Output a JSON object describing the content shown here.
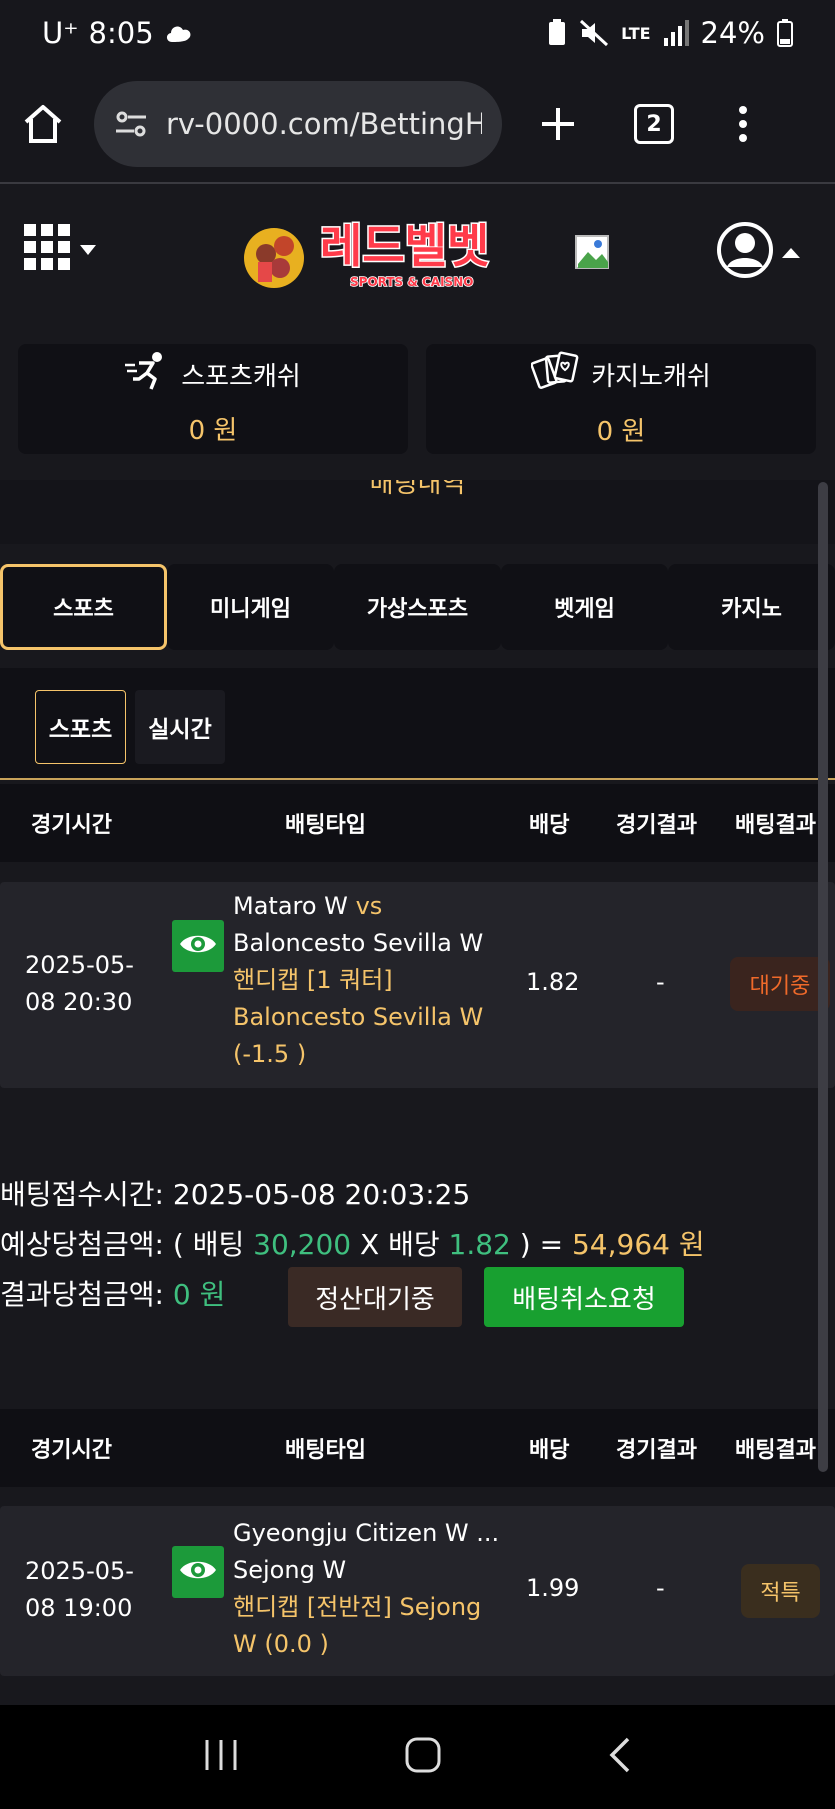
{
  "status_bar": {
    "carrier": "U⁺",
    "time": "8:05",
    "network": "LTE",
    "battery": "24%"
  },
  "browser": {
    "url": "rv-0000.com/BettingH",
    "tab_count": "2"
  },
  "site": {
    "logo_text": "레드벨벳",
    "logo_subtext": "SPORTS & CAISNO"
  },
  "wallets": [
    {
      "label": "스포츠캐쉬",
      "amount": "0 원",
      "icon": "running-icon"
    },
    {
      "label": "카지노캐쉬",
      "amount": "0 원",
      "icon": "cards-icon"
    }
  ],
  "section_title": "배팅내역",
  "tabs": [
    "스포츠",
    "미니게임",
    "가상스포츠",
    "벳게임",
    "카지노"
  ],
  "active_tab": "스포츠",
  "subtabs": [
    "스포츠",
    "실시간"
  ],
  "table_headers": [
    "경기시간",
    "배팅타입",
    "배당",
    "경기결과",
    "배팅결과"
  ],
  "bets": [
    {
      "date": "2025-05-",
      "time": "08 20:30",
      "home": "Mataro W",
      "vs": "vs",
      "away": "Baloncesto Sevilla W",
      "market_line1": "핸디캡 [1 쿼터]",
      "market_line2": "Baloncesto Sevilla W",
      "market_line3": "(-1.5 )",
      "odds": "1.82",
      "game_result": "-",
      "bet_result": "대기중",
      "bet_result_color": "#f06a2a"
    }
  ],
  "bet_summary": {
    "receipt_label": "배팅접수시간: ",
    "receipt_time": "2025-05-08 20:03:25",
    "expected_label": "예상당첨금액: ( 배팅 ",
    "bet_amount": "30,200",
    "x_odds_label": " X 배당 ",
    "odds": "1.82",
    "equals": " ) = ",
    "expected_win": "54,964 원",
    "result_label": "결과당첨금액: ",
    "result_win": "0 원",
    "settle_button": "정산대기중",
    "cancel_button": "배팅취소요청"
  },
  "second_bet": {
    "date": "2025-05-",
    "time": "08 19:00",
    "home": "Gyeongju Citizen W ...",
    "away": "Sejong W",
    "market_line1": "핸디캡 [전반전] Sejong",
    "market_line2": "W (0.0 )",
    "odds": "1.99",
    "game_result": "-",
    "bet_result": "적특",
    "bet_result_color": "#f5c46a"
  },
  "colors": {
    "accent_gold": "#f5c46a",
    "green": "#3fbf7f",
    "button_green": "#18a030"
  }
}
